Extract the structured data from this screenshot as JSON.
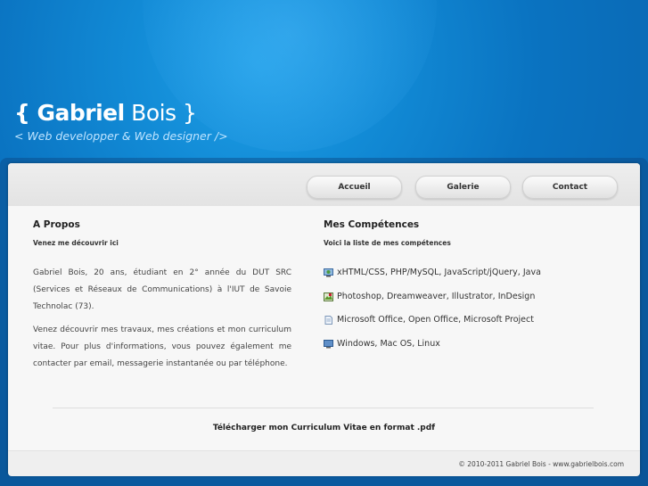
{
  "header": {
    "title_first": "{ Gabriel",
    "title_last": " Bois }",
    "tagline": "< Web developper & Web designer />"
  },
  "nav": {
    "items": [
      "Accueil",
      "Galerie",
      "Contact"
    ]
  },
  "about": {
    "title": "A Propos",
    "subtitle": "Venez me découvrir ici",
    "para1": "Gabriel Bois, 20 ans, étudiant en 2° année du DUT SRC (Services et Réseaux de Communications) à l'IUT de Savoie Technolac (73).",
    "para2": "Venez découvrir mes travaux, mes créations et mon curriculum vitae. Pour plus d'informations, vous pouvez également me contacter par email, messagerie instantanée ou par téléphone."
  },
  "skills": {
    "title": "Mes Compétences",
    "subtitle": "Voici la liste de mes compétences",
    "items": [
      {
        "icon": "monitor-globe-icon",
        "text": "xHTML/CSS, PHP/MySQL, JavaScript/jQuery, Java"
      },
      {
        "icon": "image-edit-icon",
        "text": "Photoshop, Dreamweaver, Illustrator, InDesign"
      },
      {
        "icon": "document-icon",
        "text": "Microsoft Office, Open Office, Microsoft Project"
      },
      {
        "icon": "computer-icon",
        "text": "Windows, Mac OS, Linux"
      }
    ]
  },
  "cv_link": "Télécharger mon Curriculum Vitae en format .pdf",
  "footer": {
    "copyright": "© 2010-2011 Gabriel Bois - www.gabrielbois.com"
  },
  "colors": {
    "background": "#0a73c1",
    "card": "#f7f7f7"
  }
}
